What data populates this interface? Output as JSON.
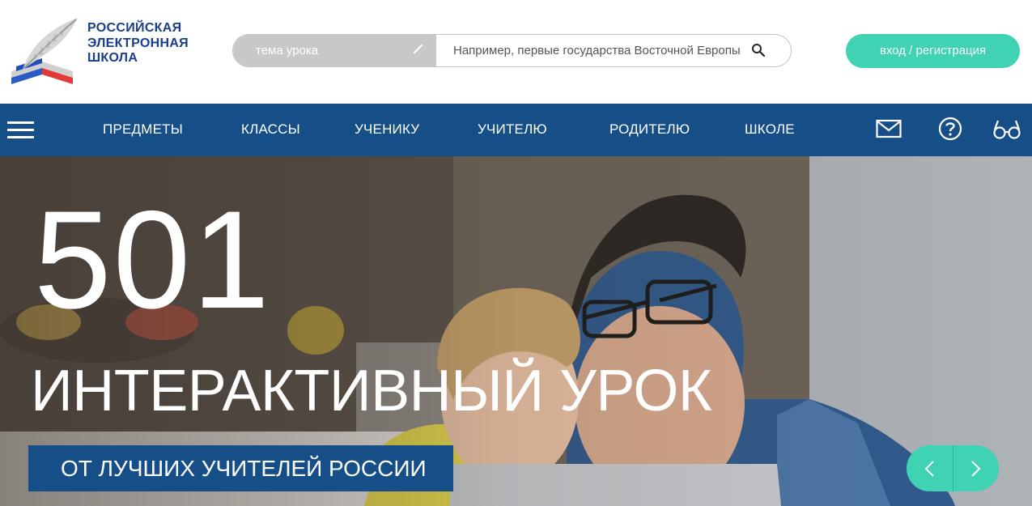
{
  "logo": {
    "line1": "РОССИЙСКАЯ",
    "line2": "ЭЛЕКТРОННАЯ",
    "line3": "ШКОЛА"
  },
  "search": {
    "type_label": "тема урока",
    "placeholder": "Например, первые государства Восточной Европы"
  },
  "auth": {
    "login_label": "вход / регистрация"
  },
  "nav": {
    "items": [
      {
        "label": "ПРЕДМЕТЫ"
      },
      {
        "label": "КЛАССЫ"
      },
      {
        "label": "УЧЕНИКУ"
      },
      {
        "label": "УЧИТЕЛЮ"
      },
      {
        "label": "РОДИТЕЛЮ"
      },
      {
        "label": "ШКОЛЕ"
      }
    ],
    "icons": [
      "envelope-icon",
      "question-icon",
      "glasses-icon"
    ]
  },
  "hero": {
    "number": "501",
    "title": "ИНТЕРАКТИВНЫЙ УРОК",
    "subtitle": "ОТ ЛУЧШИХ УЧИТЕЛЕЙ РОССИИ"
  },
  "colors": {
    "brand_blue": "#164e88",
    "logo_blue": "#1b3e8a",
    "accent_teal": "#3fd2b3",
    "search_type_gray": "#c8c8c8"
  }
}
